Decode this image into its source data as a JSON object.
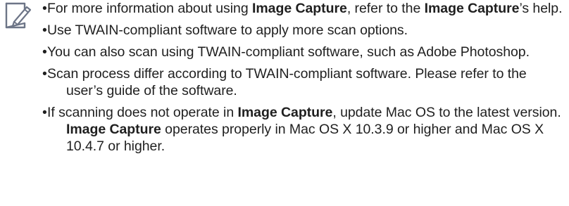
{
  "icon": "note-pencil-icon",
  "bullet": "•",
  "notes": [
    {
      "parts": [
        {
          "text": "For more information about using ",
          "bold": false
        },
        {
          "text": "Image Capture",
          "bold": true
        },
        {
          "text": ", refer to the ",
          "bold": false
        },
        {
          "text": "Image Capture",
          "bold": true
        },
        {
          "text": "’s help.",
          "bold": false
        }
      ]
    },
    {
      "parts": [
        {
          "text": "Use TWAIN-compliant software to apply more scan options.",
          "bold": false
        }
      ]
    },
    {
      "parts": [
        {
          "text": "You can also scan using TWAIN-compliant software, such as Adobe Photoshop.",
          "bold": false
        }
      ]
    },
    {
      "parts": [
        {
          "text": "Scan process differ according to TWAIN-compliant software. Please refer to the user’s guide of the software.",
          "bold": false
        }
      ]
    },
    {
      "parts": [
        {
          "text": "If scanning does not operate in ",
          "bold": false
        },
        {
          "text": "Image Capture",
          "bold": true
        },
        {
          "text": ", update Mac OS to the latest version. ",
          "bold": false
        },
        {
          "text": "Image Capture",
          "bold": true
        },
        {
          "text": " operates properly in Mac OS X 10.3.9 or higher and Mac OS X 10.4.7 or higher.",
          "bold": false
        }
      ]
    }
  ]
}
